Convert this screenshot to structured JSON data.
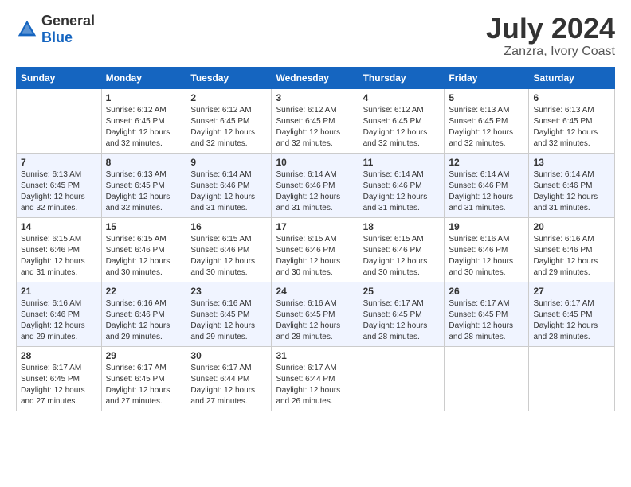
{
  "logo": {
    "general": "General",
    "blue": "Blue"
  },
  "title": "July 2024",
  "subtitle": "Zanzra, Ivory Coast",
  "days_header": [
    "Sunday",
    "Monday",
    "Tuesday",
    "Wednesday",
    "Thursday",
    "Friday",
    "Saturday"
  ],
  "weeks": [
    [
      {
        "day": "",
        "info": ""
      },
      {
        "day": "1",
        "info": "Sunrise: 6:12 AM\nSunset: 6:45 PM\nDaylight: 12 hours\nand 32 minutes."
      },
      {
        "day": "2",
        "info": "Sunrise: 6:12 AM\nSunset: 6:45 PM\nDaylight: 12 hours\nand 32 minutes."
      },
      {
        "day": "3",
        "info": "Sunrise: 6:12 AM\nSunset: 6:45 PM\nDaylight: 12 hours\nand 32 minutes."
      },
      {
        "day": "4",
        "info": "Sunrise: 6:12 AM\nSunset: 6:45 PM\nDaylight: 12 hours\nand 32 minutes."
      },
      {
        "day": "5",
        "info": "Sunrise: 6:13 AM\nSunset: 6:45 PM\nDaylight: 12 hours\nand 32 minutes."
      },
      {
        "day": "6",
        "info": "Sunrise: 6:13 AM\nSunset: 6:45 PM\nDaylight: 12 hours\nand 32 minutes."
      }
    ],
    [
      {
        "day": "7",
        "info": ""
      },
      {
        "day": "8",
        "info": "Sunrise: 6:13 AM\nSunset: 6:45 PM\nDaylight: 12 hours\nand 32 minutes."
      },
      {
        "day": "9",
        "info": "Sunrise: 6:14 AM\nSunset: 6:46 PM\nDaylight: 12 hours\nand 31 minutes."
      },
      {
        "day": "10",
        "info": "Sunrise: 6:14 AM\nSunset: 6:46 PM\nDaylight: 12 hours\nand 31 minutes."
      },
      {
        "day": "11",
        "info": "Sunrise: 6:14 AM\nSunset: 6:46 PM\nDaylight: 12 hours\nand 31 minutes."
      },
      {
        "day": "12",
        "info": "Sunrise: 6:14 AM\nSunset: 6:46 PM\nDaylight: 12 hours\nand 31 minutes."
      },
      {
        "day": "13",
        "info": "Sunrise: 6:14 AM\nSunset: 6:46 PM\nDaylight: 12 hours\nand 31 minutes."
      }
    ],
    [
      {
        "day": "14",
        "info": ""
      },
      {
        "day": "15",
        "info": "Sunrise: 6:15 AM\nSunset: 6:46 PM\nDaylight: 12 hours\nand 30 minutes."
      },
      {
        "day": "16",
        "info": "Sunrise: 6:15 AM\nSunset: 6:46 PM\nDaylight: 12 hours\nand 30 minutes."
      },
      {
        "day": "17",
        "info": "Sunrise: 6:15 AM\nSunset: 6:46 PM\nDaylight: 12 hours\nand 30 minutes."
      },
      {
        "day": "18",
        "info": "Sunrise: 6:15 AM\nSunset: 6:46 PM\nDaylight: 12 hours\nand 30 minutes."
      },
      {
        "day": "19",
        "info": "Sunrise: 6:16 AM\nSunset: 6:46 PM\nDaylight: 12 hours\nand 30 minutes."
      },
      {
        "day": "20",
        "info": "Sunrise: 6:16 AM\nSunset: 6:46 PM\nDaylight: 12 hours\nand 29 minutes."
      }
    ],
    [
      {
        "day": "21",
        "info": ""
      },
      {
        "day": "22",
        "info": "Sunrise: 6:16 AM\nSunset: 6:46 PM\nDaylight: 12 hours\nand 29 minutes."
      },
      {
        "day": "23",
        "info": "Sunrise: 6:16 AM\nSunset: 6:45 PM\nDaylight: 12 hours\nand 29 minutes."
      },
      {
        "day": "24",
        "info": "Sunrise: 6:16 AM\nSunset: 6:45 PM\nDaylight: 12 hours\nand 28 minutes."
      },
      {
        "day": "25",
        "info": "Sunrise: 6:17 AM\nSunset: 6:45 PM\nDaylight: 12 hours\nand 28 minutes."
      },
      {
        "day": "26",
        "info": "Sunrise: 6:17 AM\nSunset: 6:45 PM\nDaylight: 12 hours\nand 28 minutes."
      },
      {
        "day": "27",
        "info": "Sunrise: 6:17 AM\nSunset: 6:45 PM\nDaylight: 12 hours\nand 28 minutes."
      }
    ],
    [
      {
        "day": "28",
        "info": "Sunrise: 6:17 AM\nSunset: 6:45 PM\nDaylight: 12 hours\nand 27 minutes."
      },
      {
        "day": "29",
        "info": "Sunrise: 6:17 AM\nSunset: 6:45 PM\nDaylight: 12 hours\nand 27 minutes."
      },
      {
        "day": "30",
        "info": "Sunrise: 6:17 AM\nSunset: 6:44 PM\nDaylight: 12 hours\nand 27 minutes."
      },
      {
        "day": "31",
        "info": "Sunrise: 6:17 AM\nSunset: 6:44 PM\nDaylight: 12 hours\nand 26 minutes."
      },
      {
        "day": "",
        "info": ""
      },
      {
        "day": "",
        "info": ""
      },
      {
        "day": "",
        "info": ""
      }
    ]
  ],
  "week1_day7_info": "Sunrise: 6:13 AM\nSunset: 6:45 PM\nDaylight: 12 hours\nand 32 minutes.",
  "week3_day14_info": "Sunrise: 6:15 AM\nSunset: 6:46 PM\nDaylight: 12 hours\nand 31 minutes.",
  "week4_day21_info": "Sunrise: 6:16 AM\nSunset: 6:46 PM\nDaylight: 12 hours\nand 29 minutes."
}
